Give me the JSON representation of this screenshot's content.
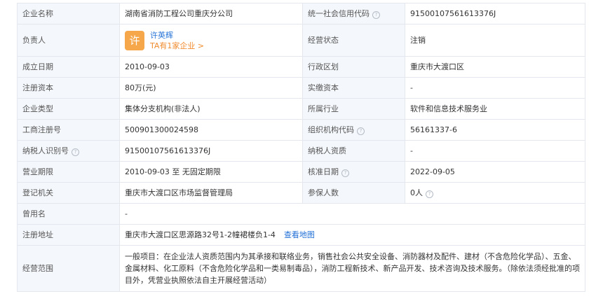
{
  "rows": [
    {
      "l1": "企业名称",
      "v1": "湖南省消防工程公司重庆分公司",
      "l2": "统一社会信用代码",
      "v2": "91500107561613376J"
    },
    {
      "l1": "负责人",
      "avatar_char": "许",
      "person_name": "许英辉",
      "person_link": "TA有1家企业 >",
      "l2": "经营状态",
      "v2": "注销"
    },
    {
      "l1": "成立日期",
      "v1": "2010-09-03",
      "l2": "行政区划",
      "v2": "重庆市大渡口区"
    },
    {
      "l1": "注册资本",
      "v1": "80万(元)",
      "l2": "实缴资本",
      "v2": "-"
    },
    {
      "l1": "企业类型",
      "v1": "集体分支机构(非法人)",
      "l2": "所属行业",
      "v2": "软件和信息技术服务业"
    },
    {
      "l1": "工商注册号",
      "v1": "500901300024598",
      "l2": "组织机构代码",
      "v2": "56161337-6"
    },
    {
      "l1": "纳税人识别号",
      "v1": "91500107561613376J",
      "l2": "纳税人资质",
      "v2": "-"
    },
    {
      "l1": "营业期限",
      "v1": "2010-09-03 至 无固定期限",
      "l2": "核准日期",
      "v2": "2022-09-05"
    },
    {
      "l1": "登记机关",
      "v1": "重庆市大渡口区市场监督管理局",
      "l2": "参保人数",
      "v2": "0人"
    },
    {
      "l1": "曾用名",
      "v1": "-"
    },
    {
      "l1": "注册地址",
      "v1": "重庆市大渡口区思源路32号1-2幢裙楼负1-4",
      "link": "查看地图"
    },
    {
      "l1": "经营范围",
      "v1": "一般项目：在企业法人资质范围内为其承接和联络业务，销售社会公共安全设备、消防器材及配件、建材（不含危险化学品）、五金、金属材料、化工原料（不含危险化学品和一类易制毒品），消防工程新技术、新产品开发、技术咨询及技术服务。（除依法须经批准的项目外，凭营业执照依法自主开展经营活动）"
    }
  ],
  "help_icon_glyph": "?",
  "colors": {
    "label_bg": "#f4f7fb",
    "border": "#e4e8ee",
    "link": "#1f6fd6",
    "orange": "#f08c2e",
    "avatar_bg": "#f5a74a"
  }
}
